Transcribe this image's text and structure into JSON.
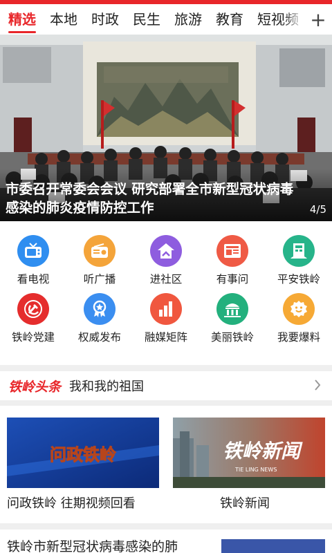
{
  "tabs": [
    "精选",
    "本地",
    "时政",
    "民生",
    "旅游",
    "教育",
    "短视频"
  ],
  "active_tab": "精选",
  "add_tab_label": "+",
  "banner": {
    "title": "市委召开常委会会议 研究部署全市新型冠状病毒感染的肺炎疫情防控工作",
    "index": "4/5"
  },
  "grid": [
    {
      "label": "看电视",
      "icon": "tv-icon",
      "color": "#2f8ef0"
    },
    {
      "label": "听广播",
      "icon": "radio-icon",
      "color": "#f4a43a"
    },
    {
      "label": "进社区",
      "icon": "community-icon",
      "color": "#8e5ddf"
    },
    {
      "label": "有事问",
      "icon": "newspaper-icon",
      "color": "#ef5a45"
    },
    {
      "label": "平安铁岭",
      "icon": "building-icon",
      "color": "#27b48a"
    },
    {
      "label": "铁岭党建",
      "icon": "party-emblem-icon",
      "color": "#e52d2d"
    },
    {
      "label": "权威发布",
      "icon": "award-icon",
      "color": "#3b8ef0"
    },
    {
      "label": "融媒矩阵",
      "icon": "bar-chart-icon",
      "color": "#f0573f"
    },
    {
      "label": "美丽铁岭",
      "icon": "landmark-icon",
      "color": "#23b07d"
    },
    {
      "label": "我要爆料",
      "icon": "face-icon",
      "color": "#f6a935"
    }
  ],
  "headline": {
    "tag": "铁岭头条",
    "text": "我和我的祖国"
  },
  "videos": [
    {
      "title": "问政铁岭 往期视频回看",
      "thumb_text": "问政铁岭"
    },
    {
      "title": "铁岭新闻",
      "thumb_text": "铁岭新闻",
      "thumb_subtext": "TIE LING NEWS"
    }
  ],
  "news_item": {
    "title": "铁岭市新型冠状病毒感染的肺"
  },
  "colors": {
    "accent": "#e8262a"
  }
}
